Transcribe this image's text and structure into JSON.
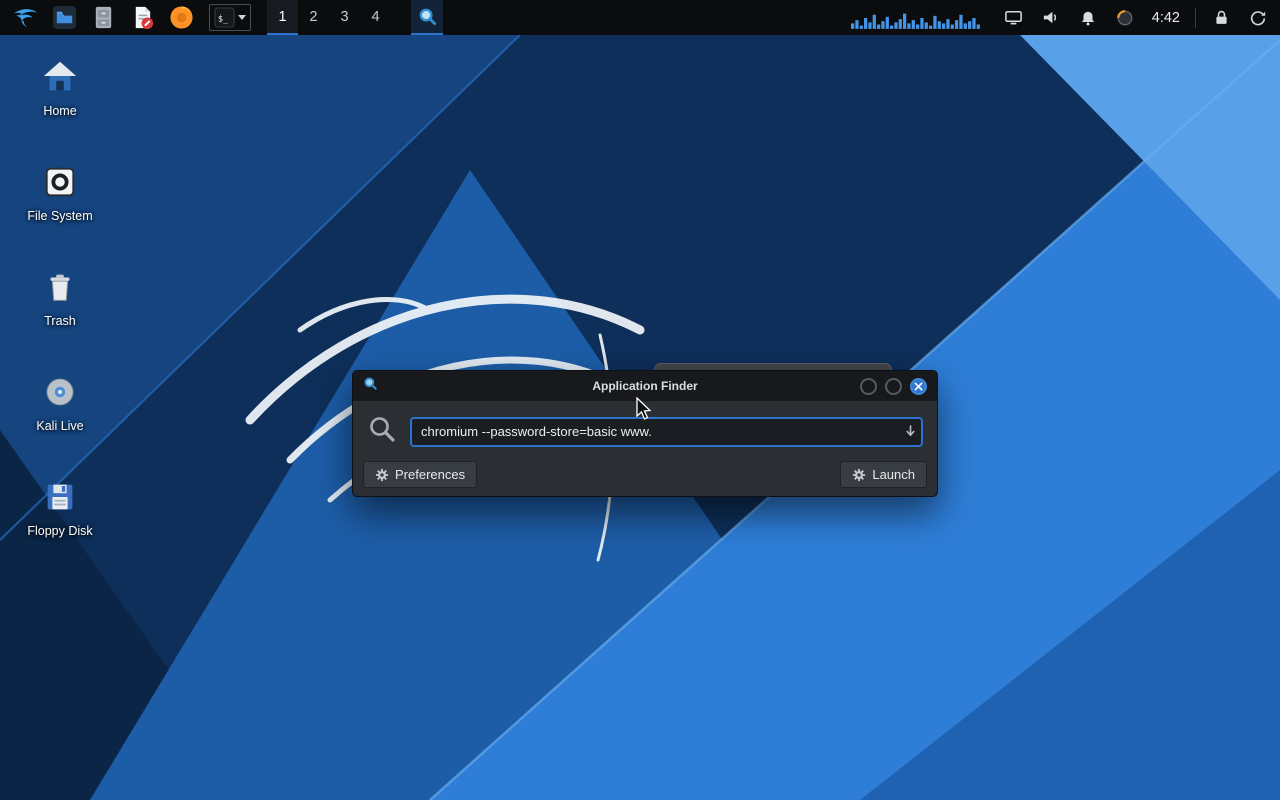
{
  "panel": {
    "launcher_icons": [
      "kali-menu-icon",
      "file-manager-icon",
      "file-cabinet-icon",
      "text-editor-icon",
      "firefox-icon",
      "terminal-icon",
      "app-finder-icon"
    ],
    "terminal_glyph": "$_",
    "workspaces": [
      "1",
      "2",
      "3",
      "4"
    ],
    "active_workspace": "1",
    "clock": "4:42",
    "tray_icons": [
      "cpu-graph",
      "display-icon",
      "volume-icon",
      "notifications-icon",
      "power-manager-icon",
      "lock-icon",
      "session-icon"
    ]
  },
  "desktop": {
    "icons": [
      {
        "label": "Home",
        "icon": "home-icon"
      },
      {
        "label": "File System",
        "icon": "drive-icon"
      },
      {
        "label": "Trash",
        "icon": "trash-icon"
      },
      {
        "label": "Kali Live",
        "icon": "disc-icon"
      },
      {
        "label": "Floppy Disk",
        "icon": "floppy-icon"
      }
    ]
  },
  "finder_window": {
    "title": "Application Finder",
    "command_input": {
      "value": "chromium --password-store=basic www."
    },
    "preferences_button": "Preferences",
    "launch_button": "Launch"
  },
  "colors": {
    "accent_blue": "#2d72cc",
    "panel_bg": "#0b0c0e",
    "window_bg": "#2b2f34",
    "titlebar_bg": "#17191c",
    "input_bg": "#1a1d21"
  }
}
